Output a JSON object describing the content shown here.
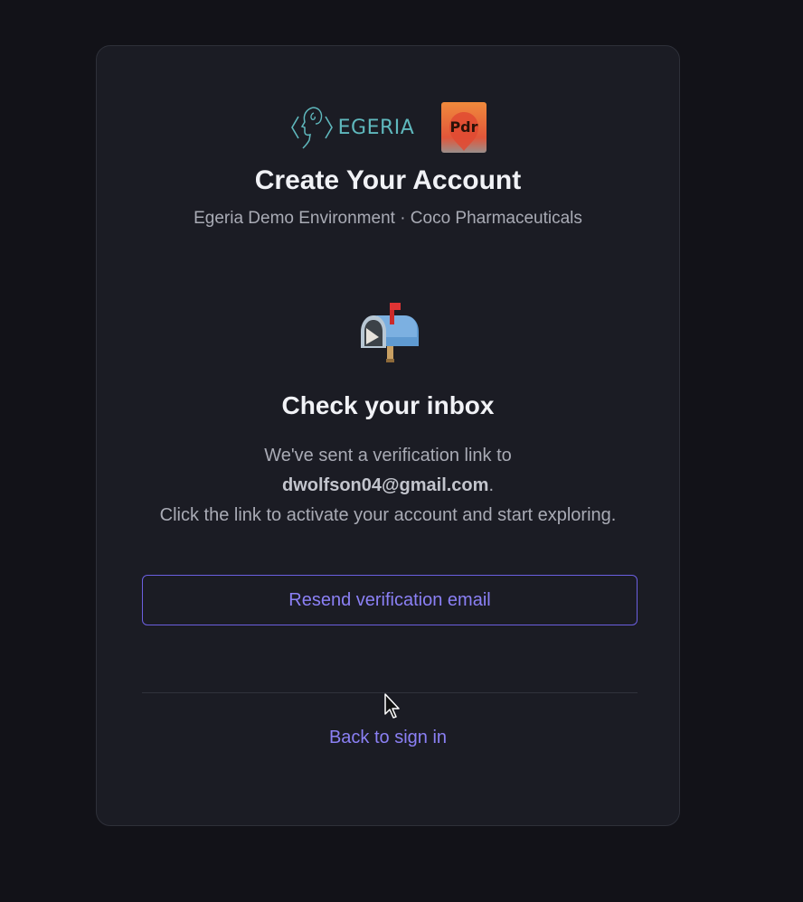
{
  "logos": {
    "egeria_text": "EGERIA",
    "pdr_text": "Pdr"
  },
  "header": {
    "title": "Create Your Account",
    "subtitle": "Egeria Demo Environment · Coco Pharmaceuticals"
  },
  "status": {
    "icon": "mailbox-icon",
    "heading": "Check your inbox",
    "message_prefix": "We've sent a verification link to",
    "email": "dwolfson04@gmail.com",
    "message_suffix": ".",
    "message_line2": "Click the link to activate your account and start exploring."
  },
  "actions": {
    "resend_label": "Resend verification email",
    "back_label": "Back to sign in"
  },
  "colors": {
    "background": "#121218",
    "card": "#1b1c24",
    "accent": "#8b80f5",
    "egeria_teal": "#5fb8bd"
  }
}
